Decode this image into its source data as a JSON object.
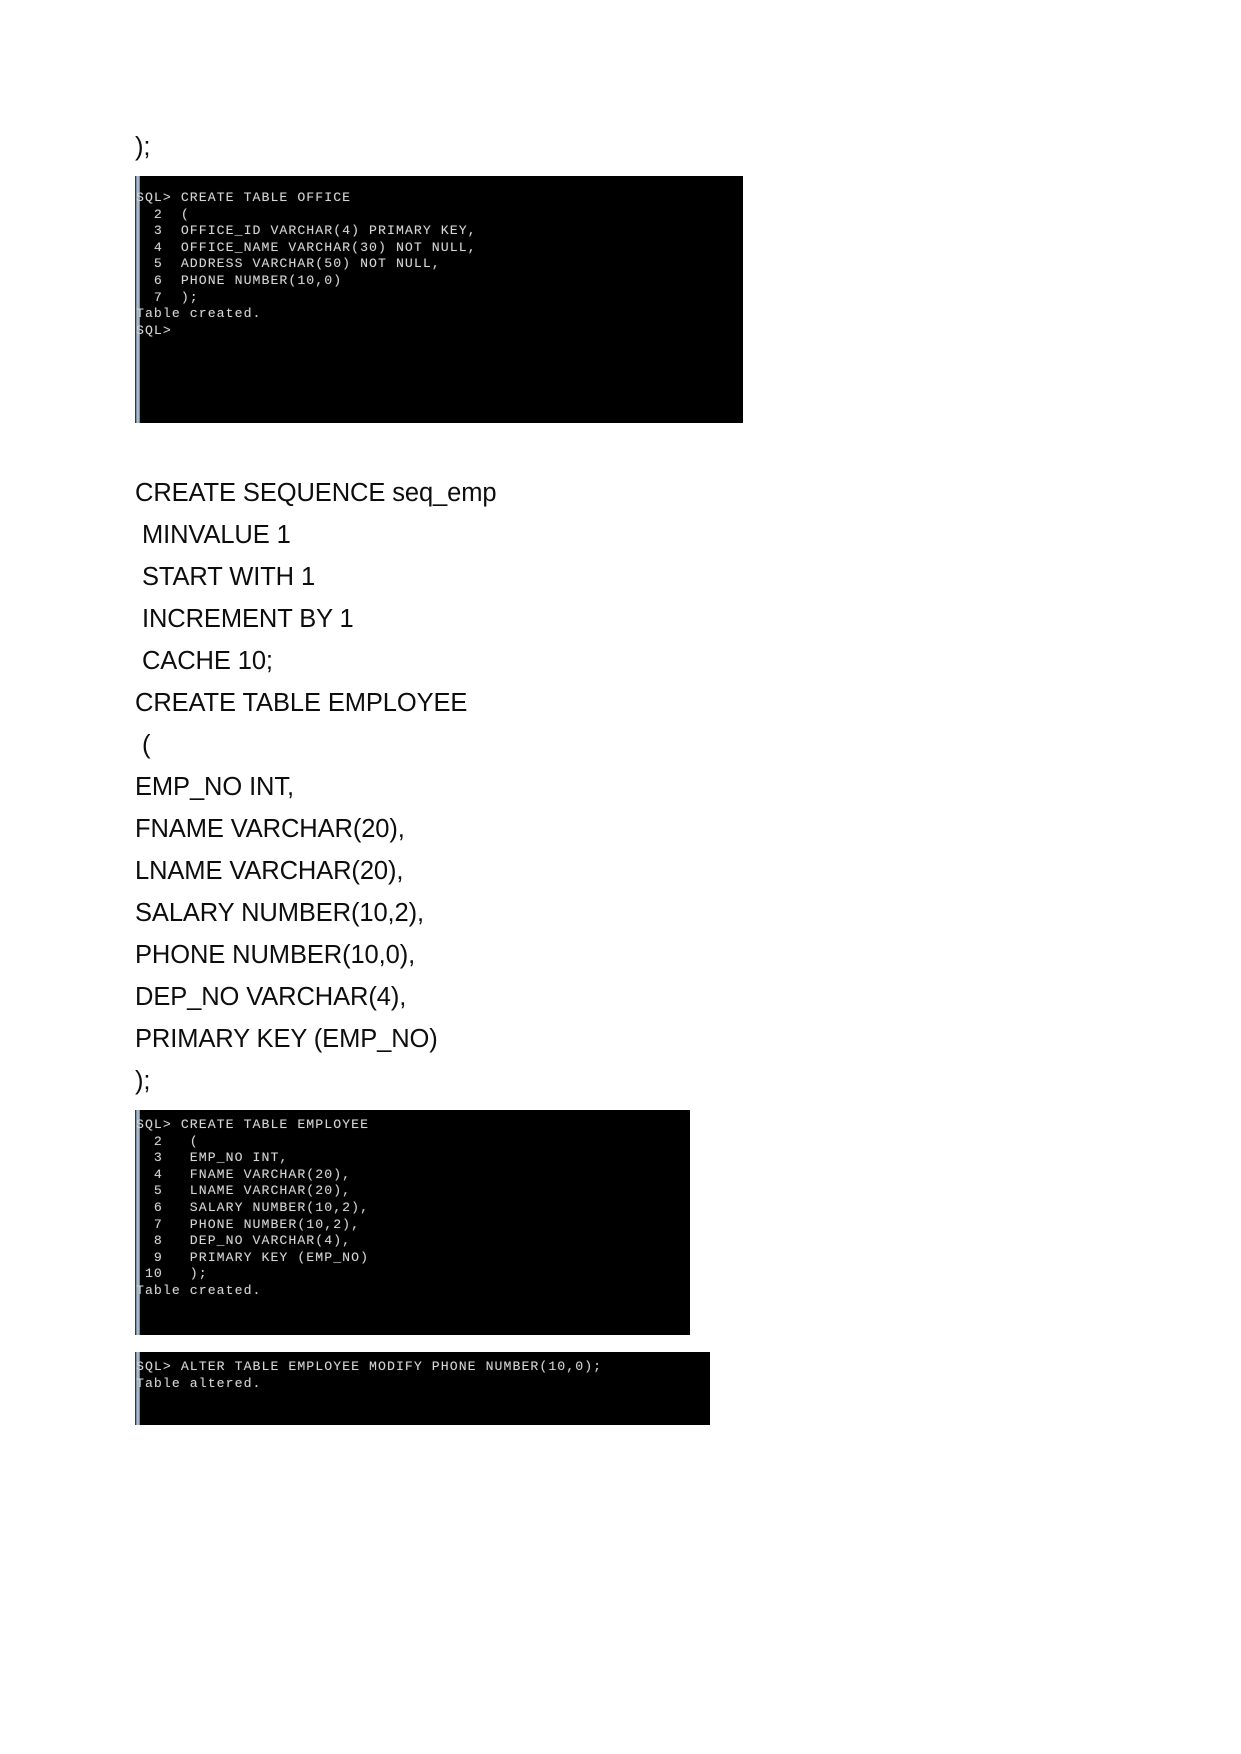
{
  "document": {
    "page_background": "#ffffff",
    "text_color": "#0d0d0d",
    "terminal_background": "#000000",
    "terminal_text_color": "#d4d4d4",
    "scrollbar_color": "#b9cbd9"
  },
  "top_fragment": {
    "line": ");"
  },
  "terminal_office": {
    "name": "sqlplus-create-table-office",
    "lines": [
      "",
      "SQL> CREATE TABLE OFFICE",
      "  2  (",
      "  3  OFFICE_ID VARCHAR(4) PRIMARY KEY,",
      "  4  OFFICE_NAME VARCHAR(30) NOT NULL,",
      "  5  ADDRESS VARCHAR(50) NOT NULL,",
      "  6  PHONE NUMBER(10,0)",
      "  7  );",
      "",
      "Table created.",
      "",
      "SQL>",
      "",
      ""
    ]
  },
  "sql_listing": {
    "lines": [
      "CREATE SEQUENCE seq_emp",
      " MINVALUE 1",
      " START WITH 1",
      " INCREMENT BY 1",
      " CACHE 10;",
      "CREATE TABLE EMPLOYEE",
      " (",
      "EMP_NO INT,",
      "FNAME VARCHAR(20),",
      "LNAME VARCHAR(20),",
      "SALARY NUMBER(10,2),",
      "PHONE NUMBER(10,0),",
      "DEP_NO VARCHAR(4),",
      "PRIMARY KEY (EMP_NO)",
      ");"
    ]
  },
  "terminal_employee": {
    "name": "sqlplus-create-table-employee",
    "lines": [
      "SQL> CREATE TABLE EMPLOYEE",
      "  2   (",
      "  3   EMP_NO INT,",
      "  4   FNAME VARCHAR(20),",
      "  5   LNAME VARCHAR(20),",
      "  6   SALARY NUMBER(10,2),",
      "  7   PHONE NUMBER(10,2),",
      "  8   DEP_NO VARCHAR(4),",
      "  9   PRIMARY KEY (EMP_NO)",
      " 10   );",
      "",
      "Table created.",
      ""
    ]
  },
  "terminal_alter": {
    "name": "sqlplus-alter-table-employee",
    "lines": [
      "SQL> ALTER TABLE EMPLOYEE MODIFY PHONE NUMBER(10,0);",
      "",
      "Table altered.",
      ""
    ]
  }
}
